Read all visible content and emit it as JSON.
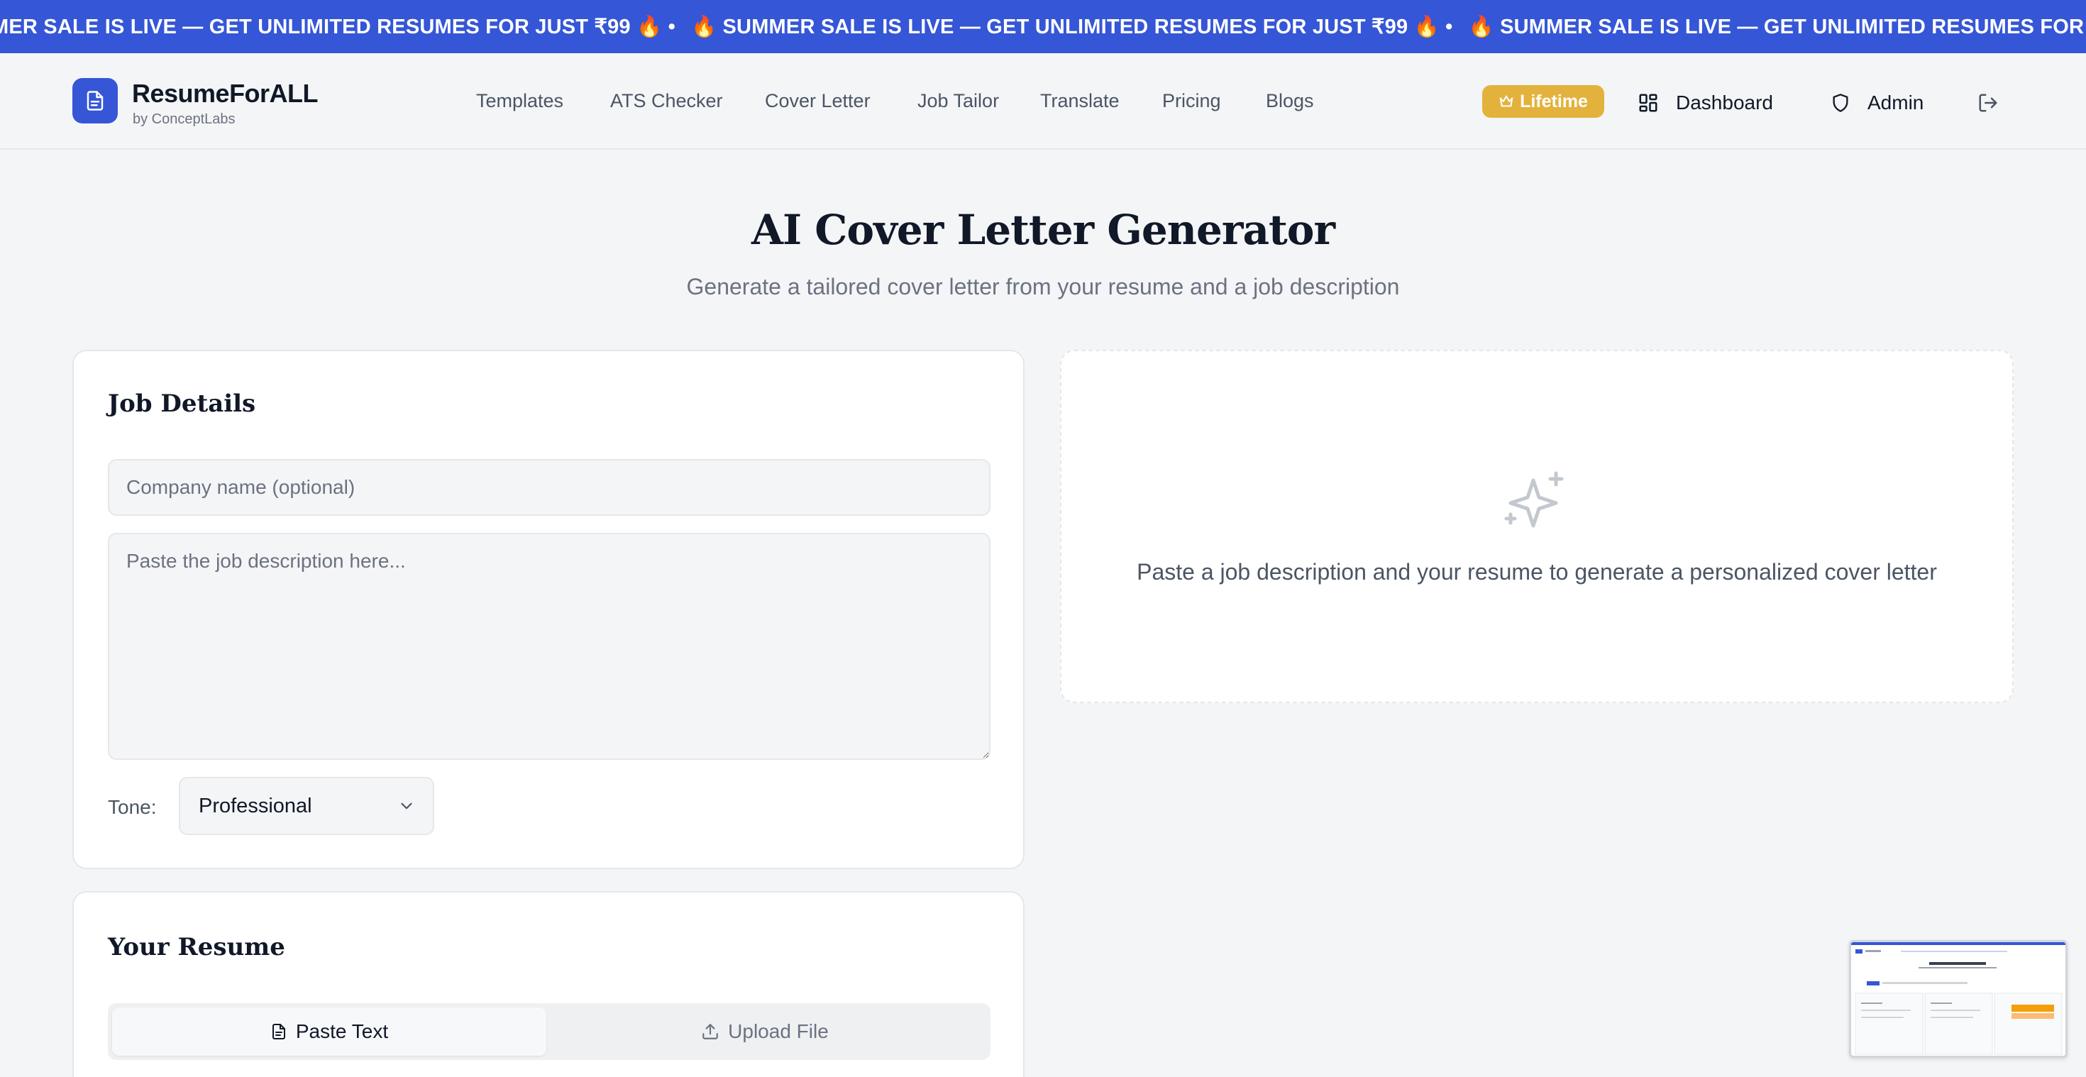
{
  "announcement": {
    "text": "🔥 SUMMER SALE IS LIVE — GET UNLIMITED RESUMES FOR JUST ₹99 🔥 •",
    "visible_segments": [
      "MER SALE IS LIVE — GET UNLIMITED RESUMES FOR JUST ₹99 🔥 •",
      "🔥 SUMMER SALE IS LIVE — GET UNLIMITED RESUMES FOR JUST ₹99 🔥 •",
      "🔥 SUMMER SALE IS LIVE — GET UNLIMITED RESUMES FOR JUST ₹99 🔥 •",
      "🔥 S"
    ]
  },
  "brand": {
    "name": "ResumeForALL",
    "byline": "by ConceptLabs",
    "logo_icon": "document-icon",
    "accent": "#3556d6"
  },
  "nav": {
    "links": [
      "Templates",
      "ATS Checker",
      "Cover Letter",
      "Job Tailor",
      "Translate",
      "Pricing",
      "Blogs"
    ]
  },
  "header_actions": {
    "lifetime_label": "Lifetime",
    "lifetime_icon": "crown-icon",
    "lifetime_color": "#e3b23c",
    "dashboard_label": "Dashboard",
    "dashboard_icon": "grid-icon",
    "admin_label": "Admin",
    "admin_icon": "shield-icon",
    "logout_icon": "logout-icon"
  },
  "page": {
    "title": "AI Cover Letter Generator",
    "subtitle": "Generate a tailored cover letter from your resume and a job description"
  },
  "job_details": {
    "title": "Job Details",
    "company_placeholder": "Company name (optional)",
    "company_value": "",
    "description_placeholder": "Paste the job description here...",
    "description_value": "",
    "tone_label": "Tone:",
    "tone_value": "Professional"
  },
  "result_placeholder": {
    "icon": "sparkles-icon",
    "text": "Paste a job description and your resume to generate a personalized cover letter"
  },
  "resume": {
    "title": "Your Resume",
    "tabs": [
      {
        "label": "Paste Text",
        "icon": "document-icon",
        "active": true
      },
      {
        "label": "Upload File",
        "icon": "upload-icon",
        "active": false
      }
    ]
  }
}
